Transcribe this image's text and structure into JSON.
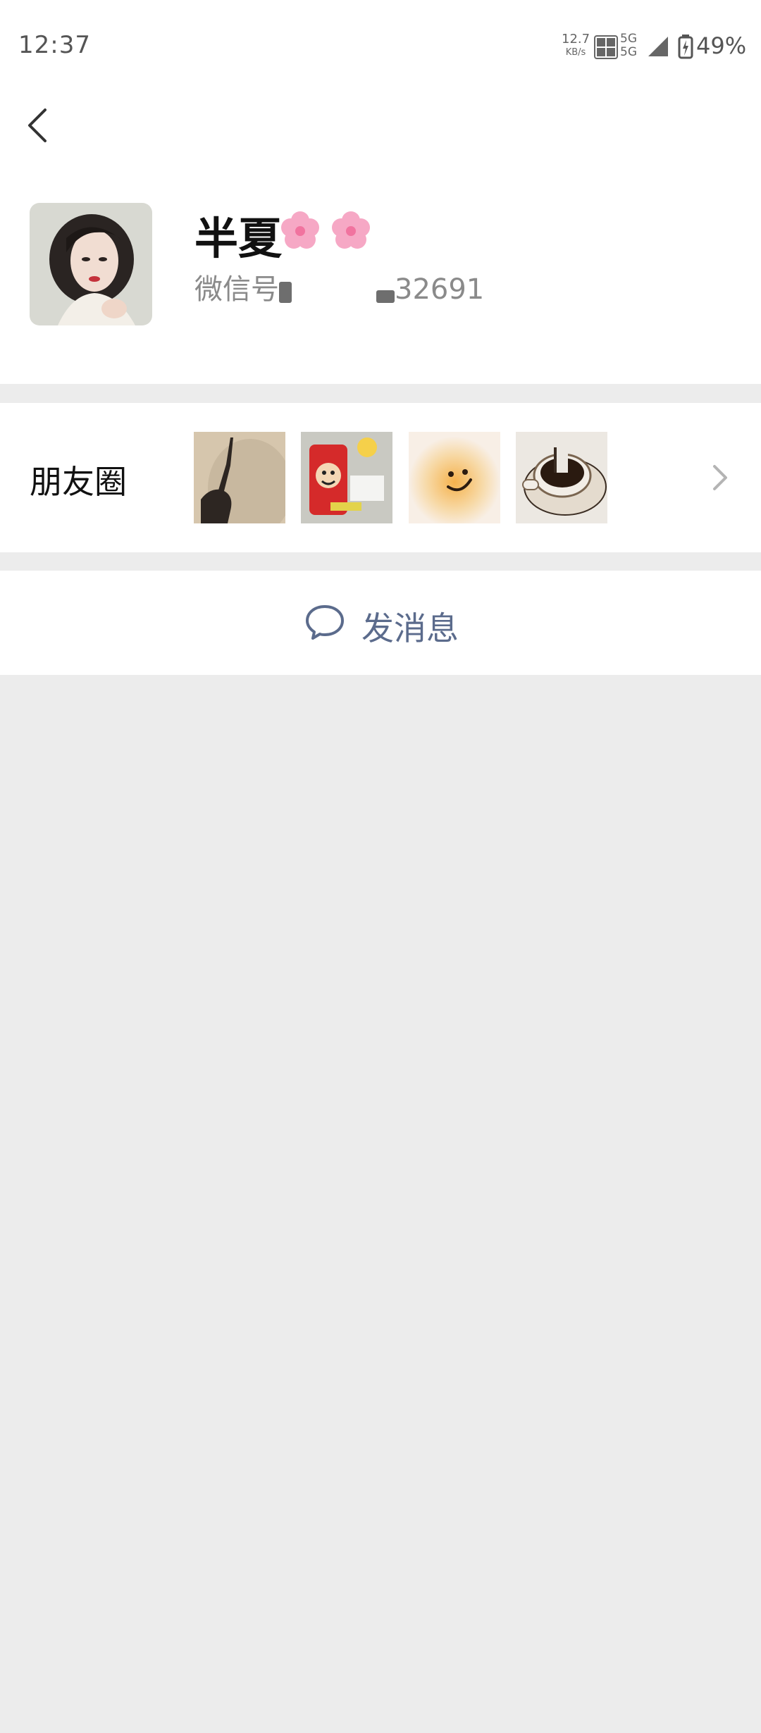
{
  "status_bar": {
    "time": "12:37",
    "net_speed_value": "12.7",
    "net_speed_unit": "KB/s",
    "network_top": "5G",
    "network_bottom": "5G",
    "battery_percent": "49%"
  },
  "profile": {
    "name": "半夏",
    "name_emoji": [
      "flower-emoji",
      "flower-emoji"
    ],
    "wechat_id_label": "微信号",
    "wechat_id_suffix": "32691"
  },
  "moments": {
    "label": "朋友圈",
    "thumbnails": [
      "shadow-photo",
      "drink-can-photo",
      "smiley-photo",
      "coffee-photo"
    ]
  },
  "actions": {
    "send_message_label": "发消息"
  },
  "colors": {
    "accent": "#5b6b8c",
    "background": "#ececec",
    "card": "#ffffff"
  }
}
